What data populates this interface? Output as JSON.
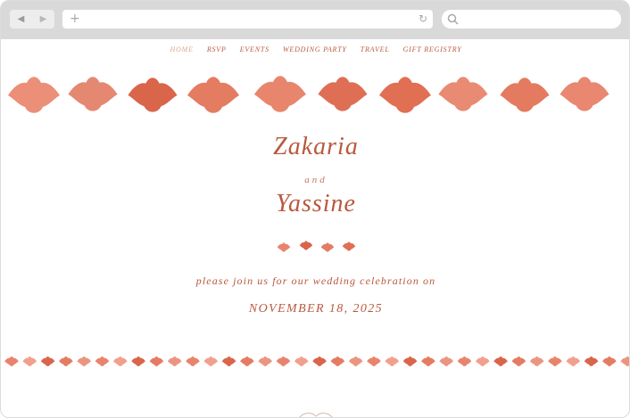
{
  "browser": {
    "back_icon": "back-arrow-icon",
    "forward_icon": "forward-arrow-icon",
    "address_icon": "plus-icon",
    "reload_icon": "reload-icon",
    "search_icon": "search-icon"
  },
  "nav": {
    "items": [
      {
        "label": "HOME",
        "active": true
      },
      {
        "label": "RSVP",
        "active": false
      },
      {
        "label": "EVENTS",
        "active": false
      },
      {
        "label": "WEDDING PARTY",
        "active": false
      },
      {
        "label": "TRAVEL",
        "active": false
      },
      {
        "label": "GIFT REGISTRY",
        "active": false
      }
    ]
  },
  "hero": {
    "name_one": "Zakaria",
    "and_word": "and",
    "name_two": "Yassine",
    "invite_line": "please join us for our wedding celebration on",
    "date": "NOVEMBER 18, 2025"
  },
  "colors": {
    "accent": "#b9583d",
    "motif": "#e8846c",
    "motif_dark": "#d4664c",
    "nav_active": "#d9a88f",
    "chrome": "#d9d9d9"
  }
}
